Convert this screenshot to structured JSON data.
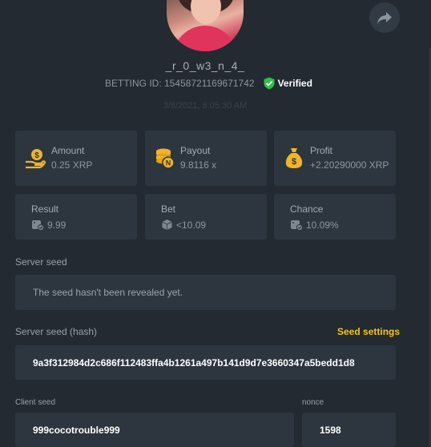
{
  "header": {
    "username": "_r_0_w3_n_4_",
    "betting_id": "BETTING ID: 15458721169671742",
    "verified_label": "Verified",
    "timestamp": "3/8/2021, 8:05:30 AM"
  },
  "stats": {
    "amount": {
      "label": "Amount",
      "value": "0.25 XRP",
      "icon": "coin-hand-icon"
    },
    "payout": {
      "label": "Payout",
      "value": "9.8116 x",
      "icon": "coin-stack-icon"
    },
    "profit": {
      "label": "Profit",
      "value": "+2.20290000 XRP",
      "icon": "money-bag-icon"
    },
    "result": {
      "label": "Result",
      "value": "9.99",
      "icon": "dice-check-icon"
    },
    "bet": {
      "label": "Bet",
      "value": "<10.09",
      "icon": "dice-icon"
    },
    "chance": {
      "label": "Chance",
      "value": "10.09%",
      "icon": "dice-check-icon"
    }
  },
  "server_seed": {
    "label": "Server seed",
    "value": "The seed hasn't been revealed yet."
  },
  "server_seed_hash": {
    "label": "Server seed (hash)",
    "settings_link": "Seed settings",
    "value": "9a3f312984d2c686f112483ffa4b1261a497b141d9d7e3660347a5bedd1d8"
  },
  "client_seed": {
    "label": "Client seed",
    "value": "999cocotrouble999"
  },
  "nonce": {
    "label": "nonce",
    "value": "1598"
  },
  "colors": {
    "background": "#232a31",
    "card": "#2d353e",
    "accent": "#f5c518",
    "verified": "#2fbf4b"
  }
}
